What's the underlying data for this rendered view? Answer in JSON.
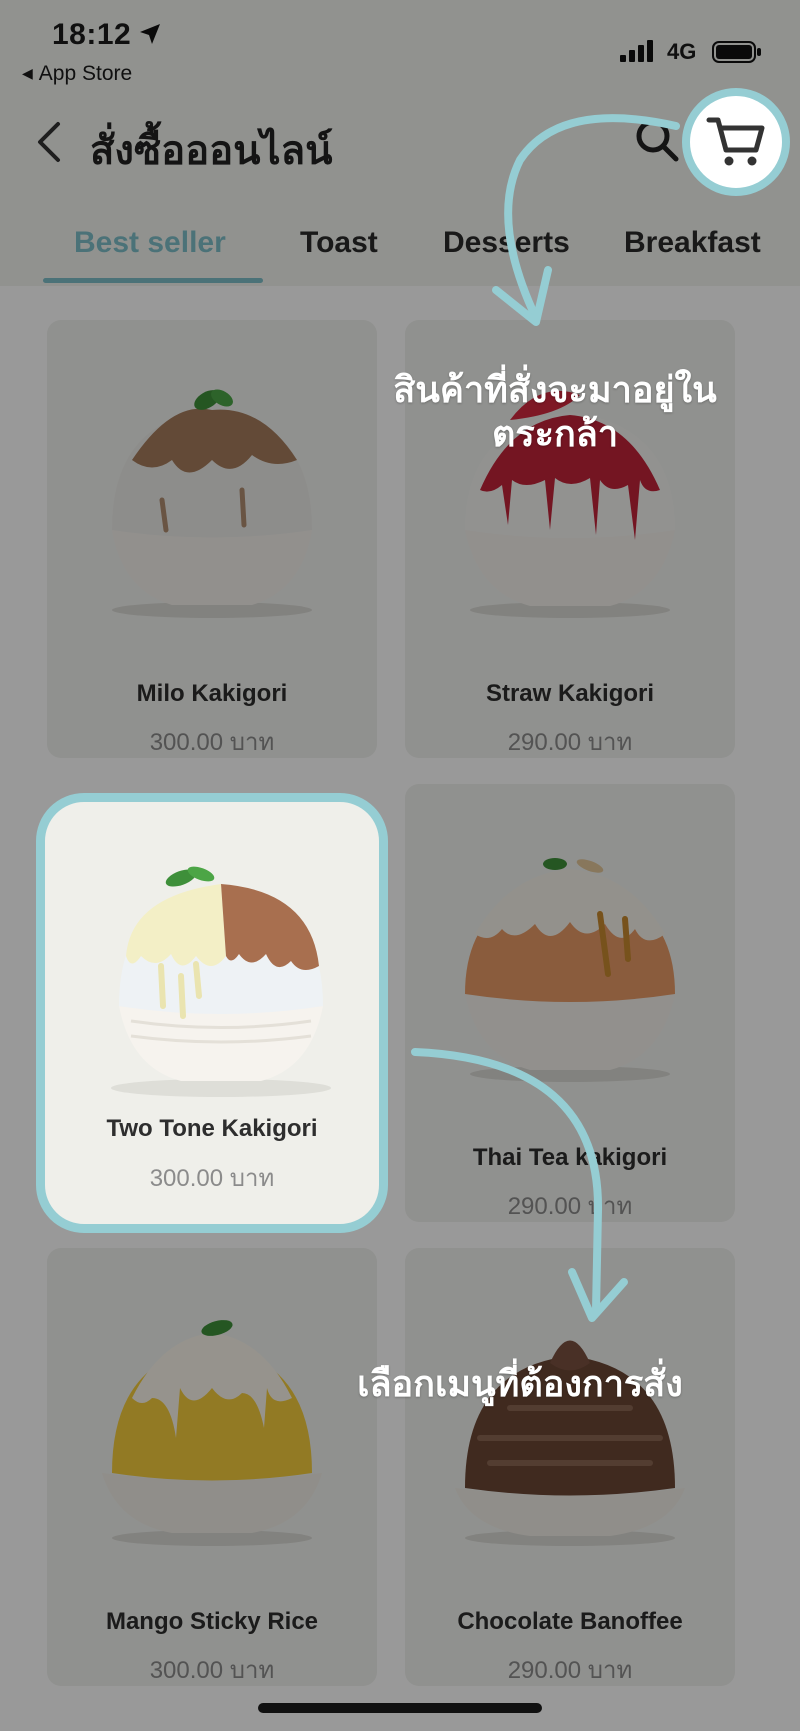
{
  "status_bar": {
    "time": "18:12",
    "back_app": "App Store",
    "network": "4G"
  },
  "header": {
    "title": "สั่งซื้อออนไลน์"
  },
  "tabs": [
    {
      "label": "Best seller",
      "active": true
    },
    {
      "label": "Toast",
      "active": false
    },
    {
      "label": "Desserts",
      "active": false
    },
    {
      "label": "Breakfast",
      "active": false
    }
  ],
  "products": [
    {
      "name": "Milo Kakigori",
      "price": "300.00 บาท"
    },
    {
      "name": "Straw Kakigori",
      "price": "290.00 บาท"
    },
    {
      "name": "Two Tone Kakigori",
      "price": "300.00 บาท"
    },
    {
      "name": "Thai Tea kakigori",
      "price": "290.00 บาท"
    },
    {
      "name": "Mango Sticky Rice",
      "price": "300.00 บาท"
    },
    {
      "name": "Chocolate Banoffee",
      "price": "290.00 บาท"
    }
  ],
  "annotations": {
    "cart_note_line1": "สินค้าที่สั่งจะมาอยู่ใน",
    "cart_note_line2": "ตระกล้า",
    "menu_note": "เลือกเมนูที่ต้องการสั่ง"
  },
  "colors": {
    "accent": "#95cdd3",
    "tab_active": "#7dbfc8",
    "overlay": "rgba(0,0,0,0.40)"
  }
}
